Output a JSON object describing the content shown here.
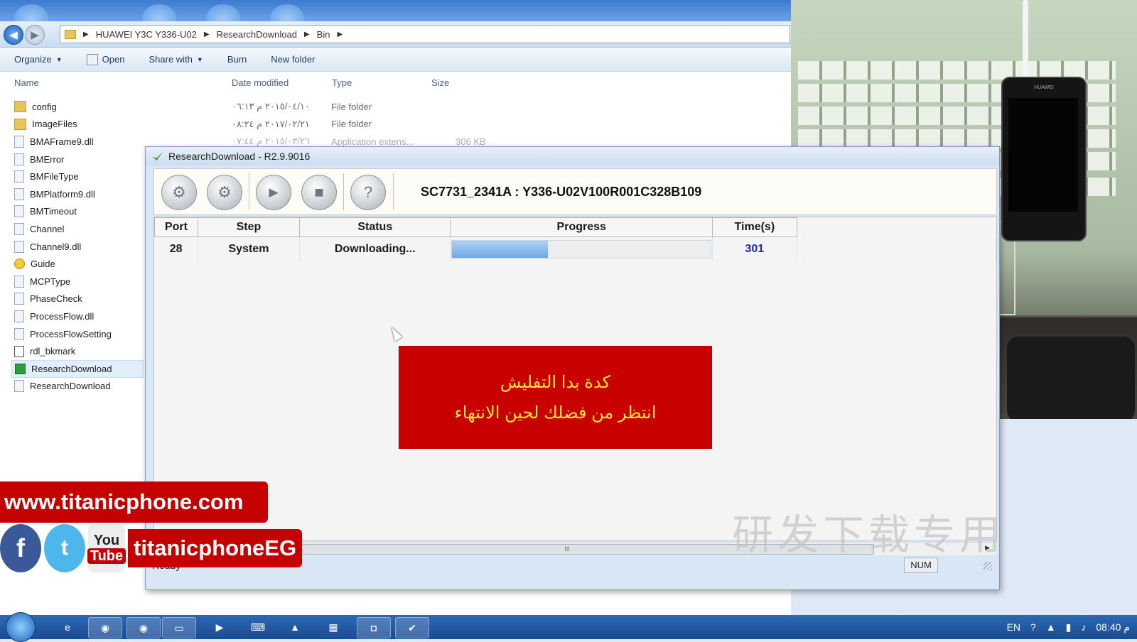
{
  "explorer": {
    "breadcrumb": [
      "HUAWEI Y3C Y336-U02",
      "ResearchDownload",
      "Bin"
    ],
    "commands": {
      "organize": "Organize",
      "open": "Open",
      "share_with": "Share with",
      "burn": "Burn",
      "new_folder": "New folder"
    },
    "columns": {
      "name": "Name",
      "date": "Date modified",
      "type": "Type",
      "size": "Size"
    },
    "files": [
      {
        "name": "config",
        "icon": "folder-icon"
      },
      {
        "name": "ImageFiles",
        "icon": "folder-icon"
      },
      {
        "name": "BMAFrame9.dll",
        "icon": "dll-file-icon"
      },
      {
        "name": "BMError",
        "icon": "config-file-icon"
      },
      {
        "name": "BMFileType",
        "icon": "config-file-icon"
      },
      {
        "name": "BMPlatform9.dll",
        "icon": "dll-file-icon"
      },
      {
        "name": "BMTimeout",
        "icon": "config-file-icon"
      },
      {
        "name": "Channel",
        "icon": "config-file-icon"
      },
      {
        "name": "Channel9.dll",
        "icon": "dll-file-icon"
      },
      {
        "name": "Guide",
        "icon": "help-file-icon"
      },
      {
        "name": "MCPType",
        "icon": "config-file-icon"
      },
      {
        "name": "PhaseCheck",
        "icon": "config-file-icon"
      },
      {
        "name": "ProcessFlow.dll",
        "icon": "dll-file-icon"
      },
      {
        "name": "ProcessFlowSetting",
        "icon": "config-file-icon"
      },
      {
        "name": "rdl_bkmark",
        "icon": "text-file-icon"
      },
      {
        "name": "ResearchDownload",
        "icon": "app-icon"
      },
      {
        "name": "ResearchDownload",
        "icon": "config-file-icon"
      }
    ],
    "meta": [
      {
        "date": "٢٠١٥/٠٤/١٠ م ٠٦:١٣",
        "type": "File folder",
        "size": ""
      },
      {
        "date": "٢٠١٧/٠٢/٢١ م ٠٨:٢٤",
        "type": "File folder",
        "size": ""
      },
      {
        "date": "٢٠١٥/٠٣/٢٦ م ٠٧:٤٤",
        "type": "Application extens...",
        "size": "306 KB"
      }
    ]
  },
  "research_download": {
    "window_title": "ResearchDownload - R2.9.9016",
    "firmware": "SC7731_2341A : Y336-U02V100R001C328B109",
    "toolbar_icons": [
      "settings-gear-icon",
      "multi-gear-icon",
      "start-play-icon",
      "stop-icon",
      "help-icon"
    ],
    "columns": [
      "Port",
      "Step",
      "Status",
      "Progress",
      "Time(s)"
    ],
    "rows": [
      {
        "port": "28",
        "step": "System",
        "status": "Downloading...",
        "progress": 0.37,
        "time": "301"
      }
    ],
    "scroll_mark": "III",
    "status": "Ready",
    "num_indicator": "NUM"
  },
  "banner": {
    "line1": "كدة بدا التفليش",
    "line2": "انتظر من فضلك لحين الانتهاء"
  },
  "phone_brand": "HUAWEI",
  "watermark": "研发下载专用",
  "promo": {
    "url": "www.titanicphone.com",
    "handle": "titanicphoneEG",
    "youtube_you": "You",
    "youtube_tube": "Tube",
    "facebook_glyph": "f",
    "twitter_glyph": "t"
  },
  "taskbar": {
    "language": "EN",
    "clock": "08:40 م"
  },
  "colors": {
    "banner_bg": "#c80000",
    "banner_text": "#ffe43b",
    "promo_red": "#c40000",
    "time_value": "#1b2aa8"
  }
}
